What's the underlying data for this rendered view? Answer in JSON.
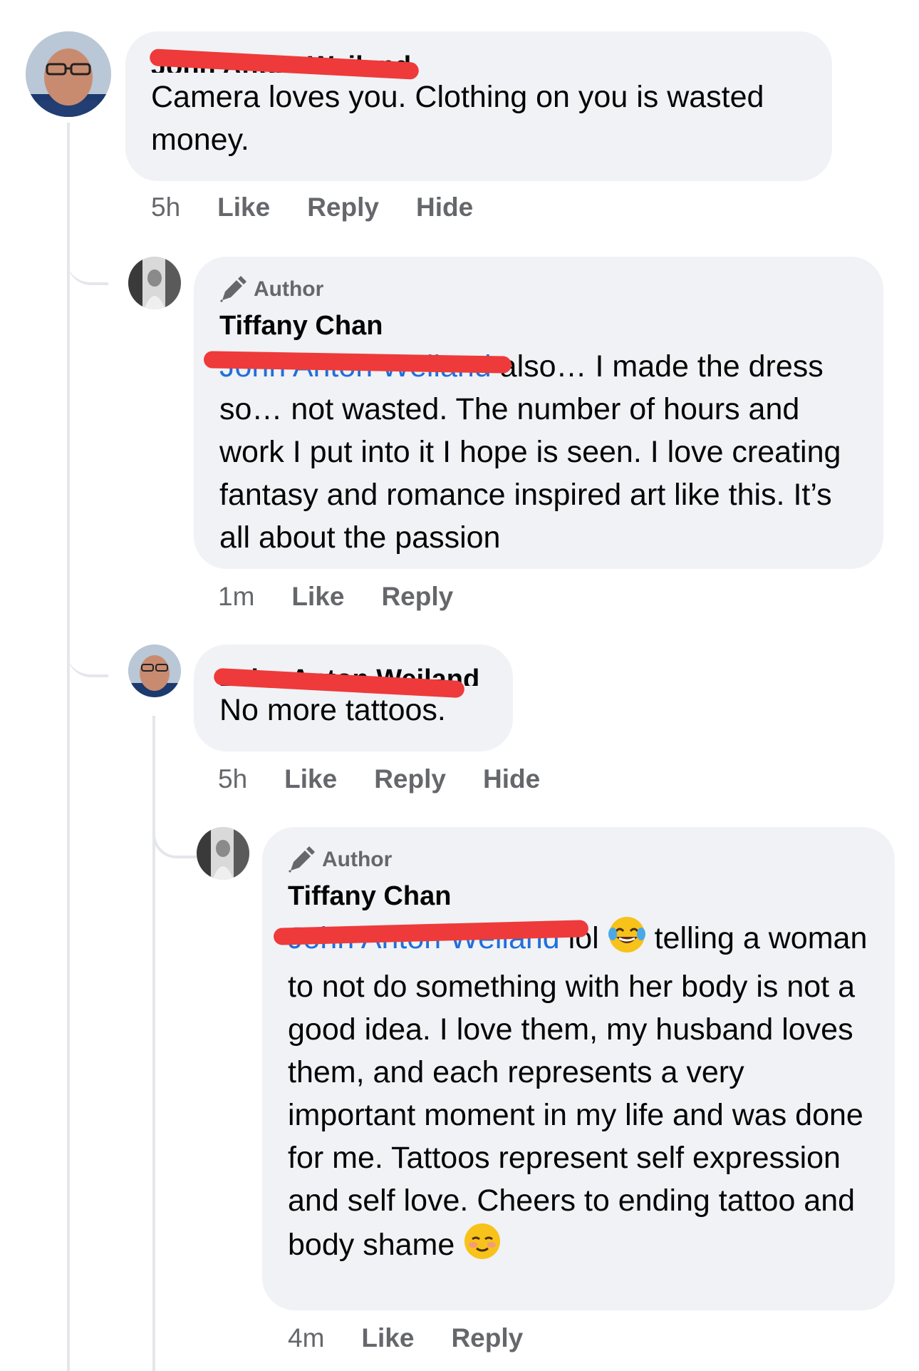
{
  "comments": [
    {
      "author": "John Anton Weiland",
      "text": "Camera loves you. Clothing on you is wasted money.",
      "time": "5h",
      "actions": [
        "Like",
        "Reply",
        "Hide"
      ]
    },
    {
      "badge": "Author",
      "author": "Tiffany Chan",
      "mention": "John Anton Weiland",
      "text": " also… I made the dress so… not wasted. The number of hours and work I put into it I hope is seen. I love creating fantasy and romance inspired art like this. It’s all about the passion",
      "time": "1m",
      "actions": [
        "Like",
        "Reply"
      ]
    },
    {
      "author": "John Anton Weiland",
      "text": "No more tattoos.",
      "time": "5h",
      "actions": [
        "Like",
        "Reply",
        "Hide"
      ]
    },
    {
      "badge": "Author",
      "author": "Tiffany Chan",
      "mention": "John Anton Weiland",
      "text_before_emoji": " lol ",
      "text_after_emoji": " telling a woman to not do something with her body is not a good idea. I love them, my husband loves them, and each represents a very important moment in my life and was done for me. Tattoos represent self expression and self love. Cheers to ending tattoo and body shame ",
      "time": "4m",
      "actions": [
        "Like",
        "Reply"
      ]
    }
  ],
  "icons": {
    "author_badge": "pencil-icon",
    "emoji_1": "laughing-tears-emoji",
    "emoji_2": "smiling-blush-emoji"
  },
  "colors": {
    "bubble": "#f0f2f5",
    "mention": "#216fdb",
    "redaction": "#ee3a3a",
    "meta": "#65676b"
  }
}
